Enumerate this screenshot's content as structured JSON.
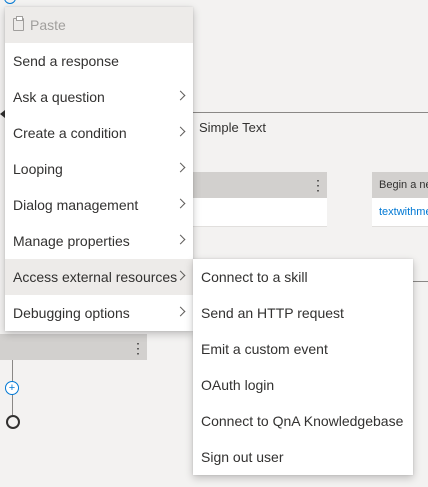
{
  "canvas": {
    "trigger_label": "Simple Text",
    "begin_node_title": "Begin a ne",
    "begin_node_link": "textwithme"
  },
  "context_menu": {
    "items": [
      {
        "label": "Paste",
        "disabled": true,
        "submenu": false
      },
      {
        "label": "Send a response",
        "submenu": false
      },
      {
        "label": "Ask a question",
        "submenu": true
      },
      {
        "label": "Create a condition",
        "submenu": true
      },
      {
        "label": "Looping",
        "submenu": true
      },
      {
        "label": "Dialog management",
        "submenu": true
      },
      {
        "label": "Manage properties",
        "submenu": true
      },
      {
        "label": "Access external resources",
        "submenu": true,
        "highlighted": true
      },
      {
        "label": "Debugging options",
        "submenu": true
      }
    ]
  },
  "submenu": {
    "items": [
      {
        "label": "Connect to a skill"
      },
      {
        "label": "Send an HTTP request"
      },
      {
        "label": "Emit a custom event"
      },
      {
        "label": "OAuth login"
      },
      {
        "label": "Connect to QnA Knowledgebase"
      },
      {
        "label": "Sign out user"
      }
    ]
  },
  "colors": {
    "canvas_bg": "#f3f2f1",
    "node_header": "#d2d0ce",
    "accent": "#0078d4",
    "menu_highlight": "#edebe9"
  }
}
